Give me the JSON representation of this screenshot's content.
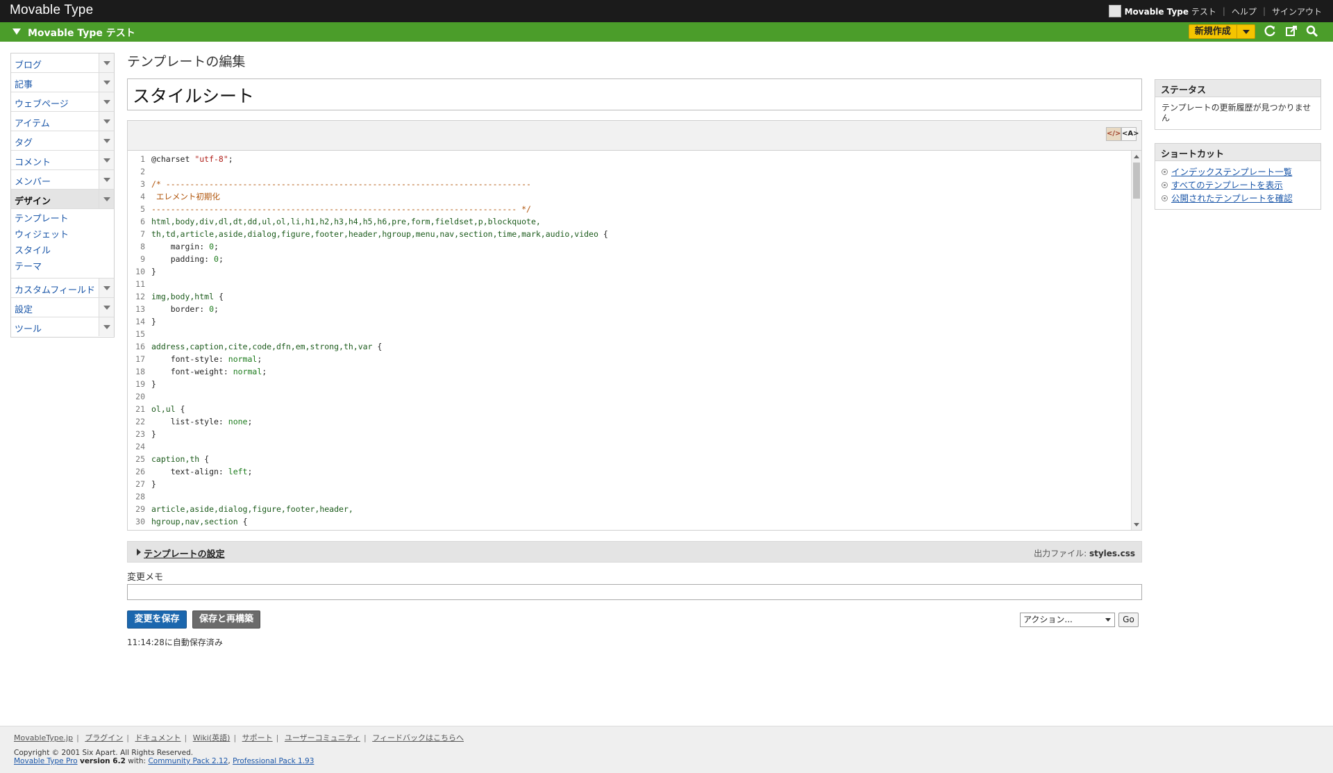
{
  "topbar": {
    "brand": "Movable Type",
    "user_site": "Movable Type",
    "user_site_suffix": "テスト",
    "help": "ヘルプ",
    "signout": "サインアウト"
  },
  "sitebar": {
    "site_name": "Movable Type テスト",
    "new_button": "新規作成"
  },
  "nav": {
    "items": [
      {
        "label": "ブログ"
      },
      {
        "label": "記事"
      },
      {
        "label": "ウェブページ"
      },
      {
        "label": "アイテム"
      },
      {
        "label": "タグ"
      },
      {
        "label": "コメント"
      },
      {
        "label": "メンバー"
      },
      {
        "label": "デザイン"
      },
      {
        "label": "カスタムフィールド"
      },
      {
        "label": "設定"
      },
      {
        "label": "ツール"
      }
    ],
    "design_sub": [
      "テンプレート",
      "ウィジェット",
      "スタイル",
      "テーマ"
    ]
  },
  "page": {
    "title": "テンプレートの編集",
    "template_name": "スタイルシート"
  },
  "editor": {
    "code_lines": [
      {
        "n": "1",
        "text": "@charset \"utf-8\";"
      },
      {
        "n": "2",
        "text": ""
      },
      {
        "n": "3",
        "text": "/* ----------------------------------------------------------------------------"
      },
      {
        "n": "4",
        "text": " エレメント初期化"
      },
      {
        "n": "5",
        "text": "---------------------------------------------------------------------------- */"
      },
      {
        "n": "6",
        "text": "html,body,div,dl,dt,dd,ul,ol,li,h1,h2,h3,h4,h5,h6,pre,form,fieldset,p,blockquote,"
      },
      {
        "n": "7",
        "text": "th,td,article,aside,dialog,figure,footer,header,hgroup,menu,nav,section,time,mark,audio,video {"
      },
      {
        "n": "8",
        "text": "    margin: 0;"
      },
      {
        "n": "9",
        "text": "    padding: 0;"
      },
      {
        "n": "10",
        "text": "}"
      },
      {
        "n": "11",
        "text": ""
      },
      {
        "n": "12",
        "text": "img,body,html {"
      },
      {
        "n": "13",
        "text": "    border: 0;"
      },
      {
        "n": "14",
        "text": "}"
      },
      {
        "n": "15",
        "text": ""
      },
      {
        "n": "16",
        "text": "address,caption,cite,code,dfn,em,strong,th,var {"
      },
      {
        "n": "17",
        "text": "    font-style: normal;"
      },
      {
        "n": "18",
        "text": "    font-weight: normal;"
      },
      {
        "n": "19",
        "text": "}"
      },
      {
        "n": "20",
        "text": ""
      },
      {
        "n": "21",
        "text": "ol,ul {"
      },
      {
        "n": "22",
        "text": "    list-style: none;"
      },
      {
        "n": "23",
        "text": "}"
      },
      {
        "n": "24",
        "text": ""
      },
      {
        "n": "25",
        "text": "caption,th {"
      },
      {
        "n": "26",
        "text": "    text-align: left;"
      },
      {
        "n": "27",
        "text": "}"
      },
      {
        "n": "28",
        "text": ""
      },
      {
        "n": "29",
        "text": "article,aside,dialog,figure,footer,header,"
      },
      {
        "n": "30",
        "text": "hgroup,nav,section {"
      }
    ],
    "mode_rich": "</>",
    "mode_plain": "<A>"
  },
  "settings": {
    "label": "テンプレートの設定",
    "output_label": "出力ファイル:",
    "output_file": "styles.css"
  },
  "memo": {
    "label": "変更メモ",
    "value": ""
  },
  "actions": {
    "save": "変更を保存",
    "save_rebuild": "保存と再構築",
    "action_select": "アクション...",
    "go": "Go",
    "autosave": "11:14:28に自動保存済み"
  },
  "status_widget": {
    "title": "ステータス",
    "body": "テンプレートの更新履歴が見つかりません"
  },
  "shortcut_widget": {
    "title": "ショートカット",
    "links": [
      "インデックステンプレート一覧",
      "すべてのテンプレートを表示",
      "公開されたテンプレートを確認"
    ]
  },
  "footer": {
    "links": [
      "MovableType.jp",
      "プラグイン",
      "ドキュメント",
      "Wiki(英語)",
      "サポート",
      "ユーザーコミュニティ",
      "フィードバックはこちらへ"
    ],
    "copyright": "Copyright © 2001 Six Apart. All Rights Reserved.",
    "product": "Movable Type Pro",
    "version": "version 6.2",
    "with": "with:",
    "pack1": "Community Pack 2.12",
    "pack2": "Professional Pack 1.93"
  },
  "colors": {
    "topbar": "#1b1b1b",
    "sitebar": "#4b9d2a",
    "new_button": "#f5c400",
    "save_button": "#1b67ae",
    "rebuild_button": "#6b6b6b"
  }
}
